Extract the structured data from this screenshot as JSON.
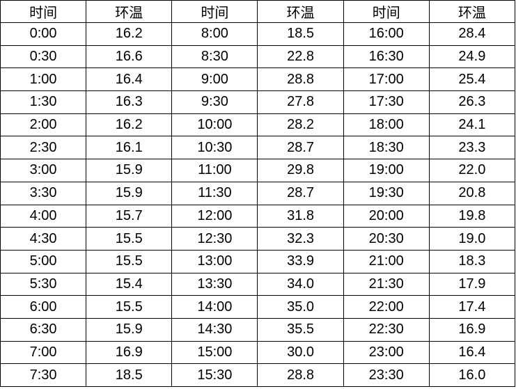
{
  "headers": [
    "时间",
    "环温",
    "时间",
    "环温",
    "时间",
    "环温"
  ],
  "rows": [
    [
      "0:00",
      "16.2",
      "8:00",
      "18.5",
      "16:00",
      "28.4"
    ],
    [
      "0:30",
      "16.6",
      "8:30",
      "22.8",
      "16:30",
      "24.9"
    ],
    [
      "1:00",
      "16.4",
      "9:00",
      "28.8",
      "17:00",
      "25.4"
    ],
    [
      "1:30",
      "16.3",
      "9:30",
      "27.8",
      "17:30",
      "26.3"
    ],
    [
      "2:00",
      "16.2",
      "10:00",
      "28.2",
      "18:00",
      "24.1"
    ],
    [
      "2:30",
      "16.1",
      "10:30",
      "28.7",
      "18:30",
      "23.3"
    ],
    [
      "3:00",
      "15.9",
      "11:00",
      "29.8",
      "19:00",
      "22.0"
    ],
    [
      "3:30",
      "15.9",
      "11:30",
      "28.7",
      "19:30",
      "20.8"
    ],
    [
      "4:00",
      "15.7",
      "12:00",
      "31.8",
      "20:00",
      "19.8"
    ],
    [
      "4:30",
      "15.5",
      "12:30",
      "32.3",
      "20:30",
      "19.0"
    ],
    [
      "5:00",
      "15.5",
      "13:00",
      "33.9",
      "21:00",
      "18.3"
    ],
    [
      "5:30",
      "15.4",
      "13:30",
      "34.0",
      "21:30",
      "17.9"
    ],
    [
      "6:00",
      "15.5",
      "14:00",
      "35.0",
      "22:00",
      "17.4"
    ],
    [
      "6:30",
      "15.9",
      "14:30",
      "35.5",
      "22:30",
      "16.9"
    ],
    [
      "7:00",
      "16.9",
      "15:00",
      "30.0",
      "23:00",
      "16.4"
    ],
    [
      "7:30",
      "18.5",
      "15:30",
      "28.8",
      "23:30",
      "16.0"
    ]
  ]
}
